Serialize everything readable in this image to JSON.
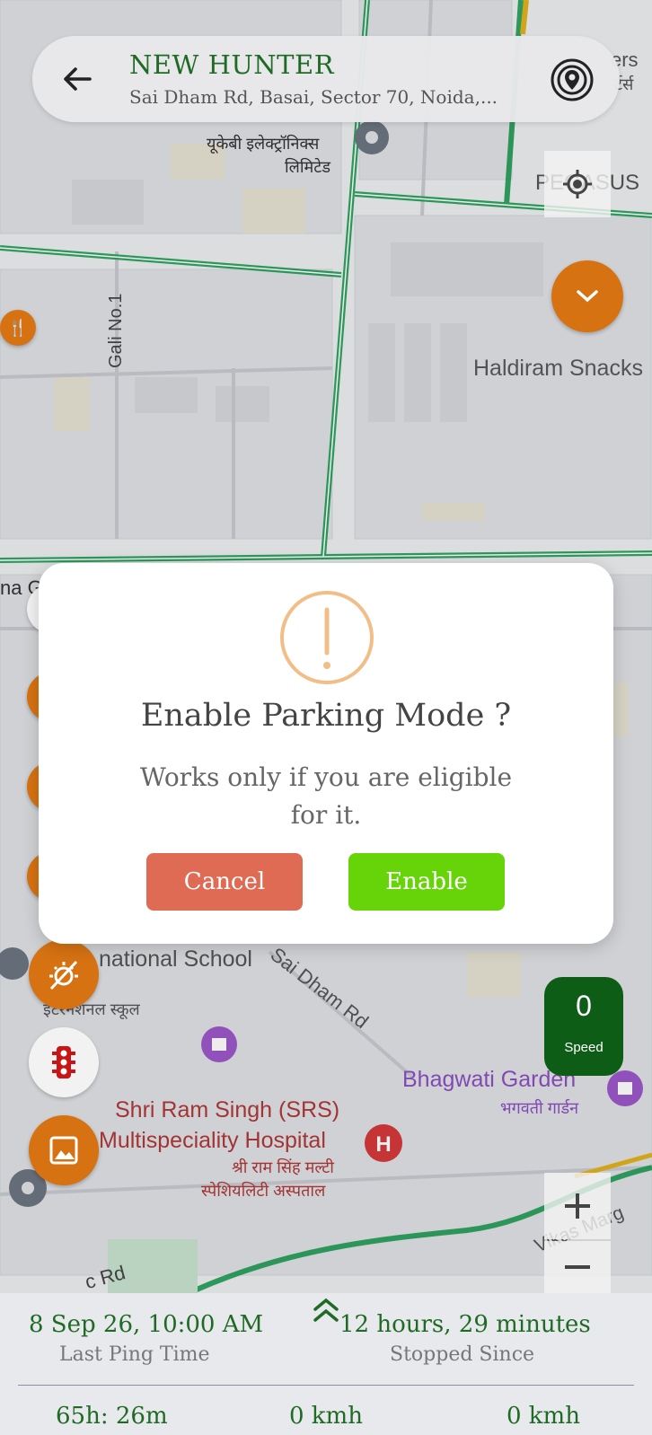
{
  "header": {
    "title": "NEW HUNTER",
    "subtitle": "Sai Dham Rd, Basai, Sector 70, Noida,..."
  },
  "map_labels": {
    "ukb_hi_1": "यूकेबी इलेक्ट्रॉनिक्स",
    "ukb_hi_2": "लिमिटेड",
    "gali": "Gali No.1",
    "haldiram": "Haldiram Snacks",
    "pegasus": "PEGASUS",
    "ers": "ers",
    "ers_hi": "र्टर्स",
    "school": "national School",
    "school_hi": "इंटरनेशनल स्कूल",
    "saidham": "Sai Dham Rd",
    "bhagwati": "Bhagwati Garden",
    "bhagwati_hi": "भगवती गार्डन",
    "hospital_1": "Shri Ram Singh (SRS)",
    "hospital_2": "Multispeciality Hospital",
    "hospital_hi_1": "श्री राम सिंह मल्टी",
    "hospital_hi_2": "स्पेशियलिटी अस्पताल",
    "vikas_marg": "Vikas Marg",
    "rd": "c Rd",
    "na_g": "na G"
  },
  "speed": {
    "value": "0",
    "label": "Speed"
  },
  "dialog": {
    "title": "Enable Parking Mode ?",
    "message": "Works only if you are eligible for it.",
    "cancel_label": "Cancel",
    "enable_label": "Enable"
  },
  "status": {
    "last_ping_value": "8 Sep 26, 10:00 AM",
    "last_ping_label": "Last Ping Time",
    "stopped_value": "12 hours, 29 minutes",
    "stopped_label": "Stopped Since",
    "duration_value": "65h: 26m",
    "speed1_value": "0 kmh",
    "speed2_value": "0 kmh"
  },
  "colors": {
    "brand_green": "#1f6b25",
    "accent_orange": "#d67212",
    "cancel": "#e06b55",
    "enable": "#66d409",
    "speed_bg": "#0e5d16"
  },
  "icons": [
    "back-arrow-icon",
    "target-icon",
    "my-location-icon",
    "chevron-down-icon",
    "restaurant-icon",
    "night-mode-icon",
    "traffic-light-icon",
    "image-icon",
    "zoom-in-icon",
    "zoom-out-icon",
    "warning-icon",
    "expand-up-icon"
  ]
}
